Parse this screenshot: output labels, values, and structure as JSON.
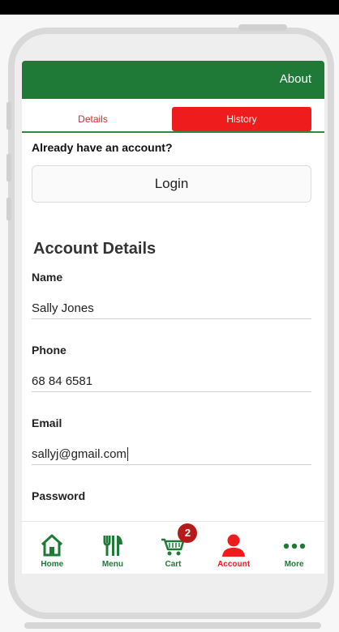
{
  "header": {
    "about_label": "About"
  },
  "tabs": [
    {
      "label": "Details",
      "active": false
    },
    {
      "label": "History",
      "active": true
    }
  ],
  "login_prompt": "Already have an account?",
  "login_button": "Login",
  "account": {
    "title": "Account Details",
    "fields": [
      {
        "label": "Name",
        "value": "Sally Jones"
      },
      {
        "label": "Phone",
        "value": "68 84 6581"
      },
      {
        "label": "Email",
        "value": "sallyj@gmail.com"
      },
      {
        "label": "Password",
        "value": ""
      }
    ]
  },
  "nav": {
    "items": [
      {
        "label": "Home",
        "icon": "home-icon"
      },
      {
        "label": "Menu",
        "icon": "utensils-icon"
      },
      {
        "label": "Cart",
        "icon": "cart-icon",
        "badge": "2"
      },
      {
        "label": "Account",
        "icon": "user-icon",
        "active": true
      },
      {
        "label": "More",
        "icon": "more-dots-icon"
      }
    ]
  },
  "colors": {
    "brand_green": "#1e7a36",
    "accent_red": "#ee1c1c",
    "badge_red": "#b51b1b"
  }
}
